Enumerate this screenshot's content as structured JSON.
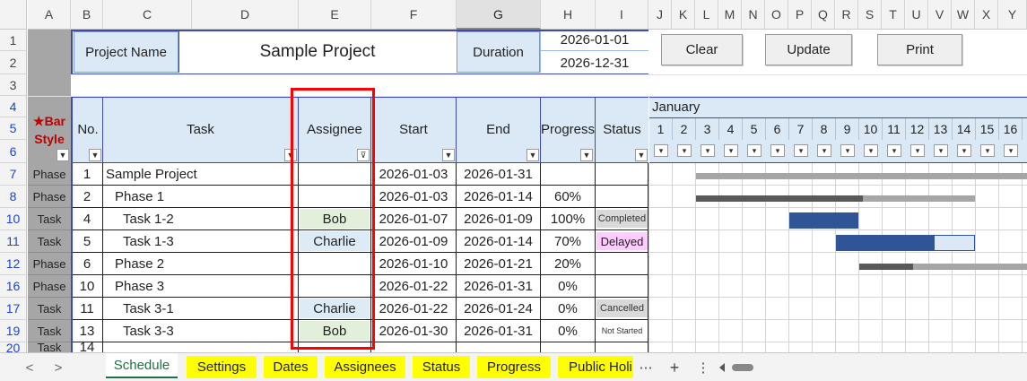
{
  "columns": [
    "A",
    "B",
    "C",
    "D",
    "E",
    "F",
    "G",
    "H",
    "I",
    "J",
    "K",
    "L",
    "M",
    "N",
    "O",
    "P",
    "Q",
    "R",
    "S",
    "T",
    "U",
    "V",
    "W",
    "X",
    "Y"
  ],
  "rows": [
    "1",
    "2",
    "3",
    "4",
    "5",
    "6",
    "7",
    "8",
    "10",
    "11",
    "12",
    "16",
    "17",
    "19",
    "20"
  ],
  "project": {
    "name_label": "Project Name",
    "name_value": "Sample Project",
    "duration_label": "Duration",
    "start": "2026-01-01",
    "end": "2026-12-31"
  },
  "buttons": {
    "clear": "Clear",
    "update": "Update",
    "print": "Print"
  },
  "headers": {
    "bar_style_star": "★Bar",
    "bar_style_2": "Style",
    "no": "No.",
    "task": "Task",
    "assignee": "Assignee",
    "start": "Start",
    "end": "End",
    "progress": "Progress",
    "status": "Status"
  },
  "gantt": {
    "month": "January",
    "days": [
      "1",
      "2",
      "3",
      "4",
      "5",
      "6",
      "7",
      "8",
      "9",
      "10",
      "11",
      "12",
      "13",
      "14",
      "15",
      "16"
    ]
  },
  "tasks": [
    {
      "style": "Phase",
      "no": "1",
      "task": "Sample Project",
      "assignee": "",
      "start": "2026-01-03",
      "end": "2026-01-31",
      "progress": "",
      "status": ""
    },
    {
      "style": "Phase",
      "no": "2",
      "task": "Phase 1",
      "assignee": "",
      "start": "2026-01-03",
      "end": "2026-01-14",
      "progress": "60%",
      "status": ""
    },
    {
      "style": "Task",
      "no": "4",
      "task": "Task 1-2",
      "assignee": "Bob",
      "start": "2026-01-07",
      "end": "2026-01-09",
      "progress": "100%",
      "status": "Completed"
    },
    {
      "style": "Task",
      "no": "5",
      "task": "Task 1-3",
      "assignee": "Charlie",
      "start": "2026-01-09",
      "end": "2026-01-14",
      "progress": "70%",
      "status": "Delayed"
    },
    {
      "style": "Phase",
      "no": "6",
      "task": "Phase 2",
      "assignee": "",
      "start": "2026-01-10",
      "end": "2026-01-21",
      "progress": "20%",
      "status": ""
    },
    {
      "style": "Phase",
      "no": "10",
      "task": "Phase 3",
      "assignee": "",
      "start": "2026-01-22",
      "end": "2026-01-31",
      "progress": "0%",
      "status": ""
    },
    {
      "style": "Task",
      "no": "11",
      "task": "Task 3-1",
      "assignee": "Charlie",
      "start": "2026-01-22",
      "end": "2026-01-24",
      "progress": "0%",
      "status": "Cancelled"
    },
    {
      "style": "Task",
      "no": "13",
      "task": "Task 3-3",
      "assignee": "Bob",
      "start": "2026-01-30",
      "end": "2026-01-31",
      "progress": "0%",
      "status": "Not Started"
    },
    {
      "style": "Task",
      "no": "14",
      "task": "",
      "assignee": "",
      "start": "",
      "end": "",
      "progress": "",
      "status": ""
    }
  ],
  "sheet_tabs": [
    "Schedule",
    "Settings",
    "Dates",
    "Assignees",
    "Status",
    "Progress",
    "Public Holi"
  ],
  "nav": {
    "prev": "<",
    "next": ">",
    "more": "⋯",
    "add": "+",
    "menu": "⋮"
  },
  "colors": {
    "assignee_bob": "#e2efda",
    "assignee_charlie": "#ddebf7",
    "status_completed": "#d9d9d9",
    "status_delayed": "#ffccff",
    "status_cancelled": "#d9d9d9",
    "bar_dark": "#2f5597",
    "bar_gray": "#595959",
    "bar_light": "#a6a6a6",
    "tab_yellow": "#ffff00",
    "highlight_red": "#ff0000"
  }
}
